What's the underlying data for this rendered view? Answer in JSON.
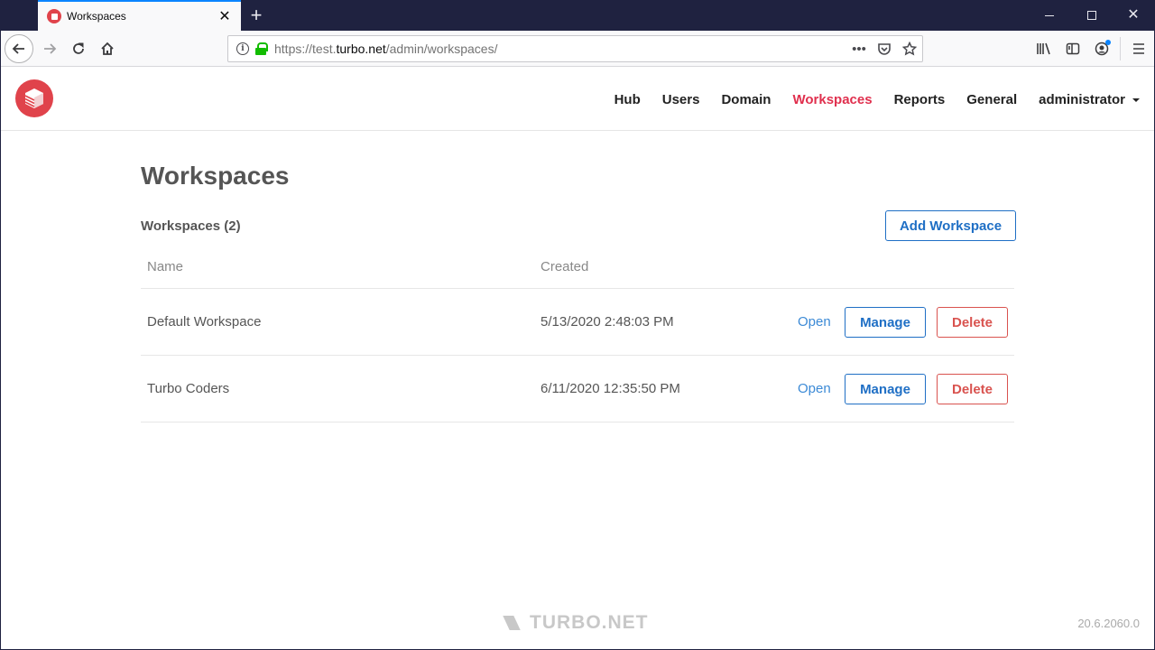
{
  "browser": {
    "tab_title": "Workspaces",
    "url_prefix": "https://test.",
    "url_domain": "turbo.net",
    "url_path": "/admin/workspaces/"
  },
  "header": {
    "nav": [
      {
        "label": "Hub",
        "active": false
      },
      {
        "label": "Users",
        "active": false
      },
      {
        "label": "Domain",
        "active": false
      },
      {
        "label": "Workspaces",
        "active": true
      },
      {
        "label": "Reports",
        "active": false
      },
      {
        "label": "General",
        "active": false
      }
    ],
    "user_menu_label": "administrator"
  },
  "main": {
    "page_title": "Workspaces",
    "section_title": "Workspaces (2)",
    "add_button_label": "Add Workspace",
    "columns": [
      "Name",
      "Created"
    ],
    "rows": [
      {
        "name": "Default Workspace",
        "created": "5/13/2020 2:48:03 PM",
        "open_label": "Open",
        "manage_label": "Manage",
        "delete_label": "Delete"
      },
      {
        "name": "Turbo Coders",
        "created": "6/11/2020 12:35:50 PM",
        "open_label": "Open",
        "manage_label": "Manage",
        "delete_label": "Delete"
      }
    ]
  },
  "footer": {
    "brand": "TURBO.NET",
    "version": "20.6.2060.0"
  },
  "colors": {
    "accent_active_nav": "#e0304e",
    "primary_blue": "#1f6fc5",
    "danger_red": "#d9534f",
    "logo_red": "#e0434b",
    "titlebar": "#1f2240"
  }
}
